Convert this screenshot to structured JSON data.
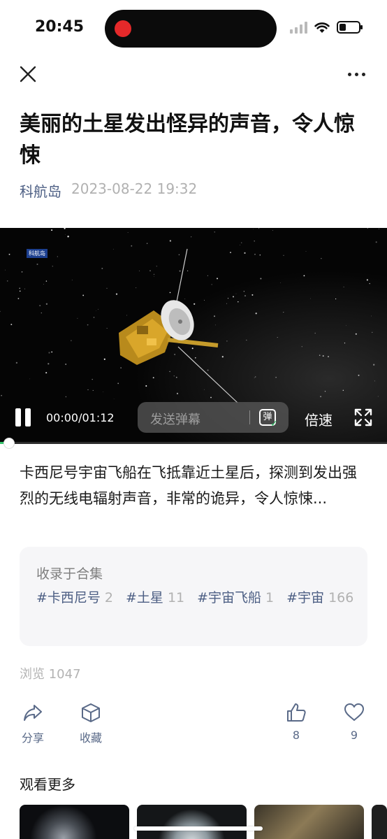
{
  "status_bar": {
    "time": "20:45"
  },
  "article": {
    "title": "美丽的土星发出怪异的声音，令人惊悚",
    "source": "科航岛",
    "published": "2023-08-22 19:32",
    "description": "卡西尼号宇宙飞船在飞抵靠近土星后，探测到发出强烈的无线电辐射声音，非常的诡异，令人惊悚..."
  },
  "video": {
    "badge": "科航岛",
    "time": "00:00/01:12",
    "progress_fraction": 0.0,
    "danmaku_placeholder": "发送弹幕",
    "danmaku_toggle": "弹",
    "speed_label": "倍速"
  },
  "collection": {
    "title": "收录于合集",
    "tags": [
      {
        "name": "#卡西尼号",
        "count": "2"
      },
      {
        "name": "#土星",
        "count": "11"
      },
      {
        "name": "#宇宙飞船",
        "count": "1"
      },
      {
        "name": "#宇宙",
        "count": "166"
      }
    ]
  },
  "stats": {
    "views": "浏览 1047"
  },
  "actions": {
    "share_label": "分享",
    "favorite_label": "收藏",
    "like_count": "8",
    "heart_count": "9"
  },
  "more": {
    "title": "观看更多"
  },
  "icons": [
    "close-icon",
    "more-icon",
    "pause-icon",
    "fullscreen-icon",
    "share-icon",
    "favorite-icon",
    "like-icon",
    "heart-icon"
  ],
  "colors": {
    "accent_link": "#4d5f84",
    "meta_gray": "#b1b1b1",
    "recording": "#e5292a",
    "progress": "#36c26b"
  }
}
